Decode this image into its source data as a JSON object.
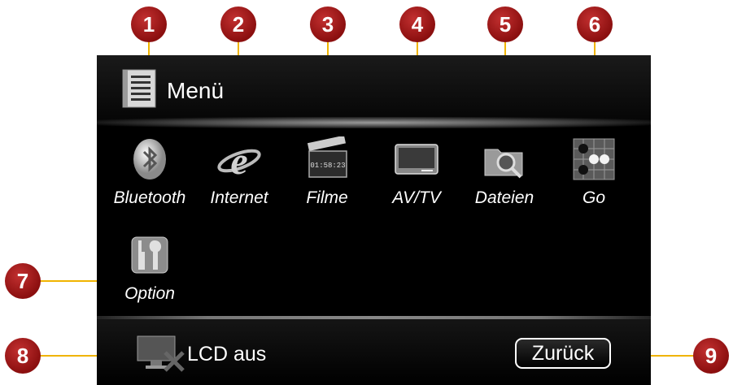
{
  "header": {
    "title": "Menü"
  },
  "apps": [
    {
      "label": "Bluetooth",
      "icon": "bluetooth-icon"
    },
    {
      "label": "Internet",
      "icon": "internet-explorer-icon"
    },
    {
      "label": "Filme",
      "icon": "clapperboard-icon",
      "clock": "01:58:23"
    },
    {
      "label": "AV/TV",
      "icon": "tv-icon"
    },
    {
      "label": "Dateien",
      "icon": "folder-search-icon"
    },
    {
      "label": "Go",
      "icon": "go-board-icon"
    },
    {
      "label": "Option",
      "icon": "tools-icon"
    }
  ],
  "footer": {
    "lcd_label": "LCD aus",
    "back_label": "Zurück"
  },
  "callouts": [
    "1",
    "2",
    "3",
    "4",
    "5",
    "6",
    "7",
    "8",
    "9"
  ],
  "colors": {
    "badge": "#8b0f0f",
    "line": "#f0b400",
    "screen": "#000000"
  }
}
